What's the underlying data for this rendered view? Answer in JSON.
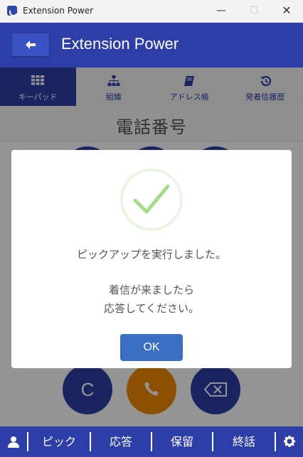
{
  "window": {
    "title": "Extension Power",
    "minimize": "—",
    "maximize": "☐",
    "close": "✕"
  },
  "header": {
    "title": "Extension Power"
  },
  "tabs": [
    {
      "label": "キーパッド",
      "icon": "keypad-grid-icon",
      "active": true
    },
    {
      "label": "組織",
      "icon": "org-chart-icon",
      "active": false
    },
    {
      "label": "アドレス帳",
      "icon": "book-icon",
      "active": false
    },
    {
      "label": "発着信履歴",
      "icon": "history-icon",
      "active": false
    }
  ],
  "phone": {
    "title": "電話番号"
  },
  "keypad": {
    "clear_label": "C"
  },
  "bottom_bar": {
    "pickup": "ピック",
    "answer": "応答",
    "hold": "保留",
    "hangup": "終話"
  },
  "dialog": {
    "message_line1": "ピックアップを実行しました。",
    "message_line2": "着信が来ましたら",
    "message_line3": "応答してください。",
    "ok_label": "OK"
  },
  "colors": {
    "primary": "#2d3ea8",
    "call": "#f28c00",
    "success": "#a5dc86",
    "ok_button": "#3a6fc4"
  }
}
